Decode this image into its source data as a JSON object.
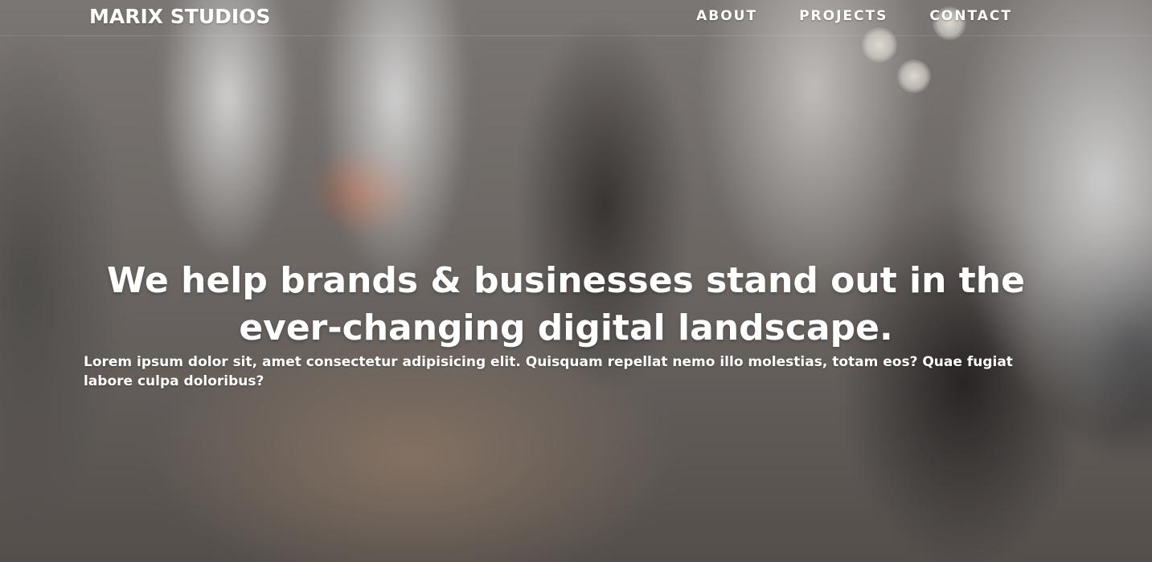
{
  "brand": {
    "name": "MARIX STUDIOS"
  },
  "nav": {
    "items": [
      {
        "label": "ABOUT"
      },
      {
        "label": "PROJECTS"
      },
      {
        "label": "CONTACT"
      }
    ]
  },
  "hero": {
    "headline": "We help brands & businesses stand out in the ever-changing digital landscape.",
    "lead": "Lorem ipsum dolor sit, amet consectetur adipisicing elit. Quisquam repellat nemo illo molestias, totam eos? Quae fugiat labore culpa doloribus?",
    "background_image": "blurred-office-photo"
  },
  "colors": {
    "text": "#ffffff"
  }
}
